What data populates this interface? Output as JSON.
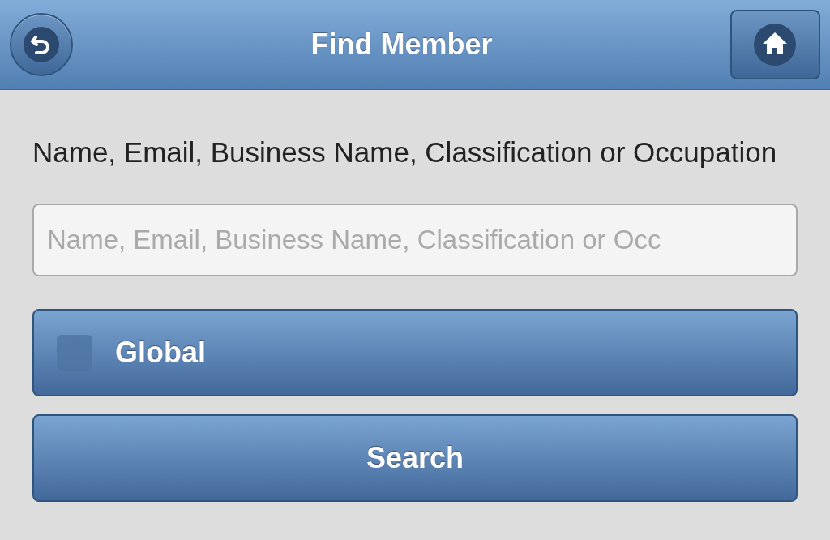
{
  "header": {
    "title": "Find Member"
  },
  "search": {
    "label": "Name, Email, Business Name, Classification or Occupation",
    "placeholder": "Name, Email, Business Name, Classification or Occ"
  },
  "global": {
    "label": "Global",
    "checked": false
  },
  "buttons": [
    "Search"
  ]
}
